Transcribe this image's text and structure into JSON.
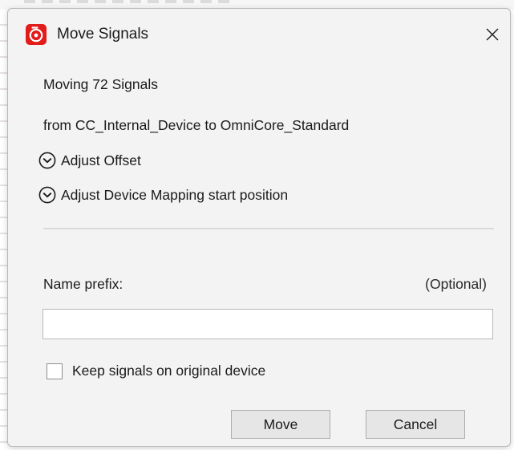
{
  "window": {
    "title": "Move Signals",
    "app_icon": "robotstudio-app-icon",
    "close_glyph": "✕"
  },
  "summary": {
    "moving_text": "Moving 72 Signals",
    "from_to_text": "from CC_Internal_Device to OmniCore_Standard"
  },
  "expanders": [
    {
      "label": "Adjust Offset",
      "icon": "chevron-down-circle-icon",
      "expanded": false
    },
    {
      "label": "Adjust Device Mapping start position",
      "icon": "chevron-down-circle-icon",
      "expanded": false
    }
  ],
  "name_prefix": {
    "label": "Name prefix:",
    "hint": "(Optional)",
    "value": "",
    "placeholder": ""
  },
  "keep_signals": {
    "label": "Keep signals on original device",
    "checked": false
  },
  "buttons": {
    "move_label": "Move",
    "cancel_label": "Cancel"
  },
  "colors": {
    "accent": "#e21b1b",
    "dialog_bg": "#f3f3f3",
    "button_bg": "#e6e6e6",
    "divider": "#d9d9d9"
  }
}
